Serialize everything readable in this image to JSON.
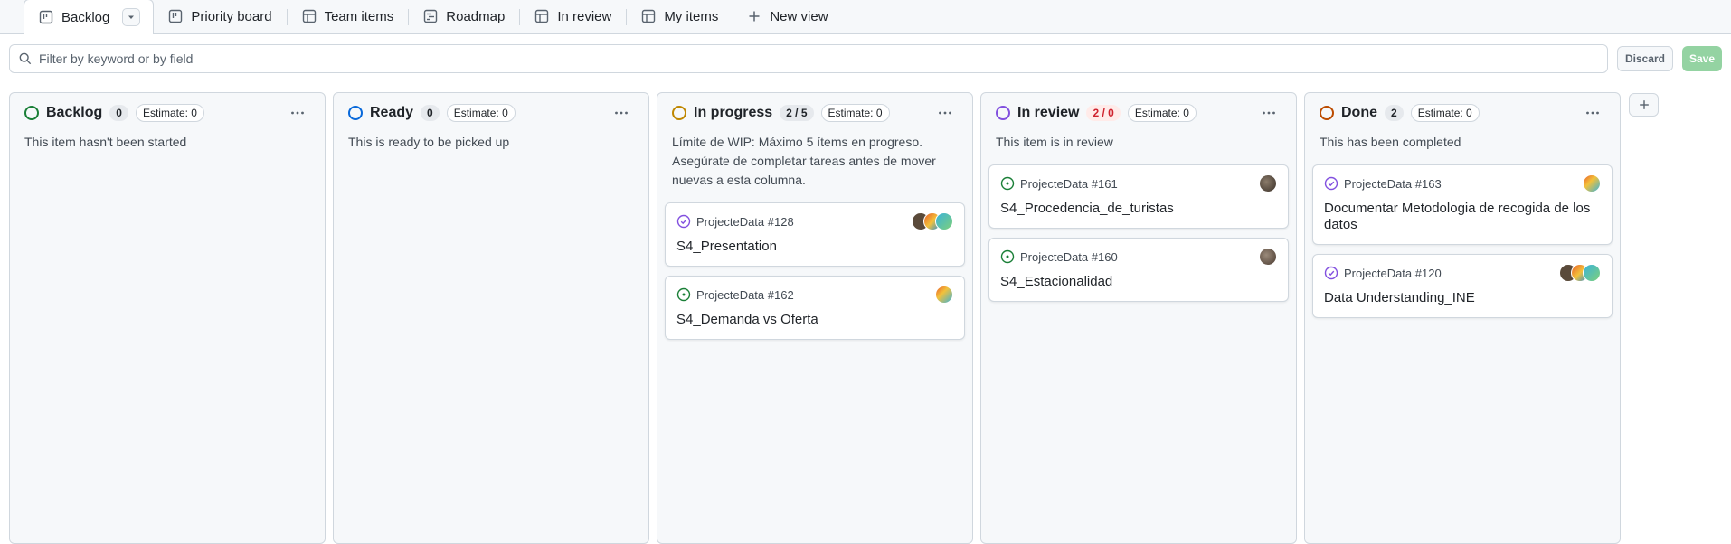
{
  "tabs": [
    {
      "label": "Backlog",
      "icon": "board-icon",
      "active": true
    },
    {
      "label": "Priority board",
      "icon": "board-icon"
    },
    {
      "label": "Team items",
      "icon": "table-icon"
    },
    {
      "label": "Roadmap",
      "icon": "roadmap-icon"
    },
    {
      "label": "In review",
      "icon": "table-icon"
    },
    {
      "label": "My items",
      "icon": "table-icon"
    }
  ],
  "new_view_label": "New view",
  "filter": {
    "placeholder": "Filter by keyword or by field"
  },
  "actions": {
    "discard": "Discard",
    "save": "Save"
  },
  "columns": [
    {
      "title": "Backlog",
      "count": "0",
      "estimate": "Estimate: 0",
      "color": "#1a7f37",
      "description": "This item hasn't been started",
      "cards": []
    },
    {
      "title": "Ready",
      "count": "0",
      "estimate": "Estimate: 0",
      "color": "#0969da",
      "description": "This is ready to be picked up",
      "cards": []
    },
    {
      "title": "In progress",
      "count": "2 / 5",
      "estimate": "Estimate: 0",
      "color": "#bf8700",
      "description": "Límite de WIP: Máximo 5 ítems en progreso. Asegúrate de completar tareas antes de mover nuevas a esta columna.",
      "cards": [
        {
          "ref": "ProjecteData #128",
          "title": "S4_Presentation",
          "status": "closed"
        },
        {
          "ref": "ProjecteData #162",
          "title": "S4_Demanda vs Oferta",
          "status": "open"
        }
      ]
    },
    {
      "title": "In review",
      "count": "2 / 0",
      "count_alert": true,
      "estimate": "Estimate: 0",
      "color": "#8250df",
      "description": "This item is in review",
      "cards": [
        {
          "ref": "ProjecteData #161",
          "title": "S4_Procedencia_de_turistas",
          "status": "open"
        },
        {
          "ref": "ProjecteData #160",
          "title": "S4_Estacionalidad",
          "status": "open"
        }
      ]
    },
    {
      "title": "Done",
      "count": "2",
      "estimate": "Estimate: 0",
      "color": "#bc4c00",
      "description": "This has been completed",
      "cards": [
        {
          "ref": "ProjecteData #163",
          "title": "Documentar Metodologia de recogida de los datos",
          "status": "closed"
        },
        {
          "ref": "ProjecteData #120",
          "title": "Data Understanding_INE",
          "status": "closed"
        }
      ]
    }
  ]
}
